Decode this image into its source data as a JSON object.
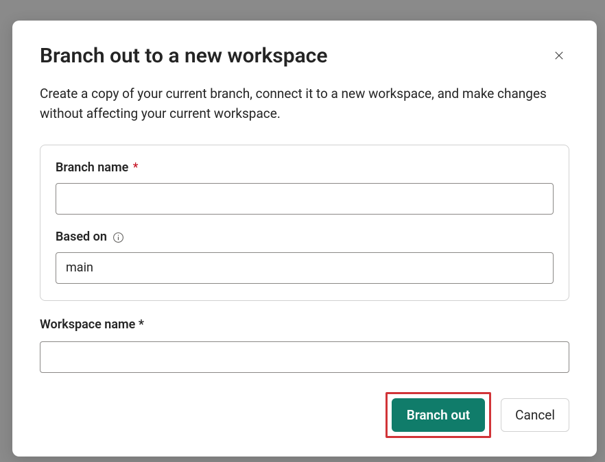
{
  "modal": {
    "title": "Branch out to a new workspace",
    "description": "Create a copy of your current branch, connect it to a new workspace, and make changes without affecting your current workspace."
  },
  "form": {
    "branch_name": {
      "label": "Branch name",
      "value": ""
    },
    "based_on": {
      "label": "Based on",
      "value": "main"
    },
    "workspace_name": {
      "label": "Workspace name",
      "value": ""
    }
  },
  "buttons": {
    "primary": "Branch out",
    "secondary": "Cancel"
  }
}
